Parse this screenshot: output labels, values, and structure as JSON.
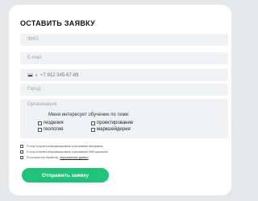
{
  "form": {
    "title": "ОСТАВИТЬ ЗАЯВКУ",
    "fields": {
      "name_placeholder": "ФИО",
      "email_placeholder": "E-mail",
      "phone_value": "+7 912 345-67-89",
      "city_placeholder": "Город",
      "org_placeholder": "Организация"
    },
    "interest": {
      "title": "Меня интересует обучение по теме:",
      "options": [
        "геодезия",
        "проектирование",
        "геология",
        "маркшейдерия"
      ]
    },
    "consents": [
      {
        "text": "Я хочу получать информационные и рекламные материалы",
        "link": ""
      },
      {
        "text": "Я хочу получать информационные и рекламные SMS-рассылки",
        "link": ""
      },
      {
        "text": "Я согласен на обработку",
        "link": "персональных данных"
      }
    ],
    "submit_label": "Отправить заявку"
  },
  "colors": {
    "accent": "#1fc37a",
    "field_bg": "#f1f2f4",
    "page_bg": "#e6e7e9"
  }
}
